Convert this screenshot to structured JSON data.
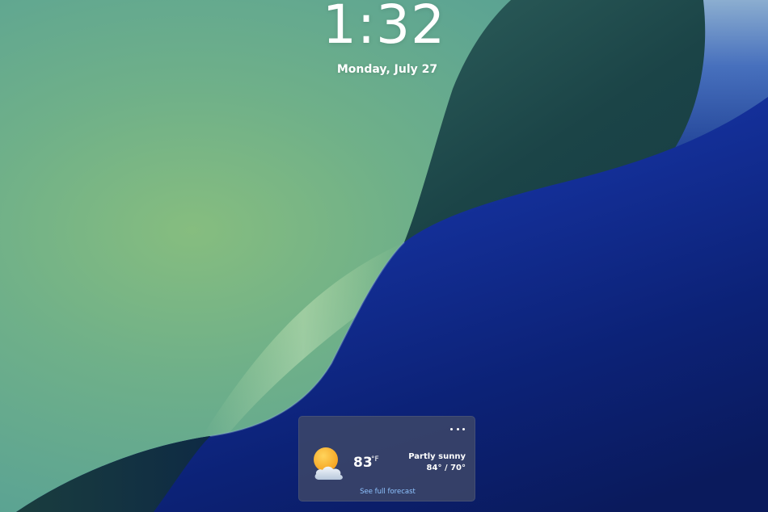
{
  "lock_screen": {
    "time": "1:32",
    "date": "Monday, July 27"
  },
  "weather": {
    "icon": "partly-sunny-icon",
    "temperature": "83",
    "unit": "°F",
    "condition": "Partly sunny",
    "high_low": "84° / 70°",
    "link_label": "See full forecast",
    "more_icon": "more-options-icon"
  },
  "colors": {
    "green_wallpaper": "#5fa58f",
    "deep_blue": "#0c1f78",
    "dark_teal": "#1e4a4c",
    "card_background": "#3e4868",
    "link": "#8fc3ff"
  }
}
